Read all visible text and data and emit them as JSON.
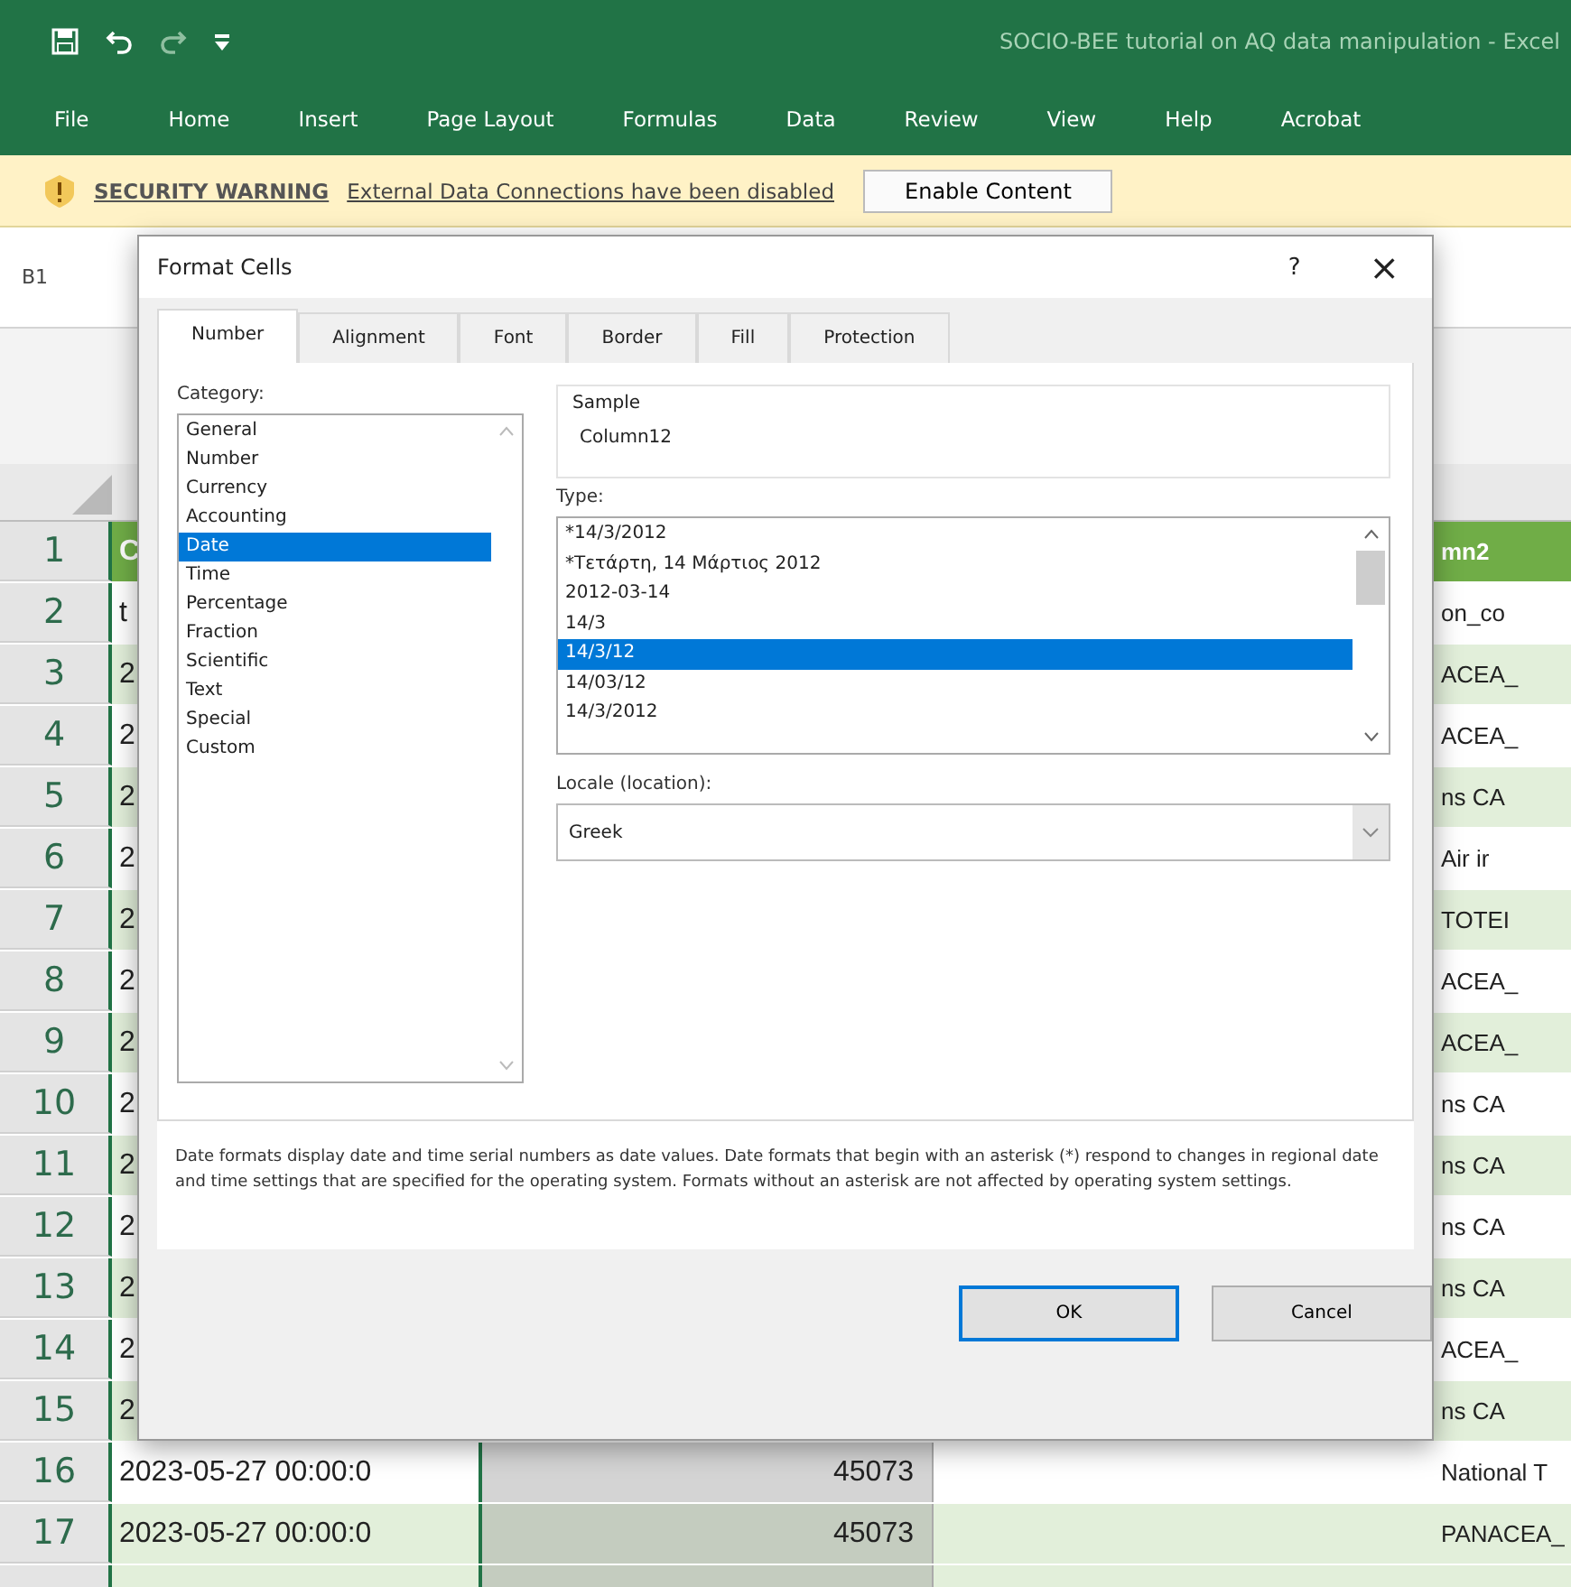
{
  "window": {
    "title": "SOCIO-BEE tutorial on AQ data manipulation  -  Excel"
  },
  "ribbon_tabs": [
    "File",
    "Home",
    "Insert",
    "Page Layout",
    "Formulas",
    "Data",
    "Review",
    "View",
    "Help",
    "Acrobat"
  ],
  "security_bar": {
    "label": "SECURITY WARNING",
    "message": "External Data Connections have been disabled",
    "button": "Enable Content"
  },
  "name_box": "B1",
  "sheet": {
    "rows": [
      {
        "number": "1",
        "col_a": "C",
        "col_d": "mn2"
      },
      {
        "number": "2",
        "col_a": "t",
        "col_d": "on_co"
      },
      {
        "number": "3",
        "col_a": "2",
        "col_d": "ACEA_"
      },
      {
        "number": "4",
        "col_a": "2",
        "col_d": "ACEA_"
      },
      {
        "number": "5",
        "col_a": "2",
        "col_d": "ns CA"
      },
      {
        "number": "6",
        "col_a": "2",
        "col_d": "Air ir"
      },
      {
        "number": "7",
        "col_a": "2",
        "col_d": "TOTEI"
      },
      {
        "number": "8",
        "col_a": "2",
        "col_d": "ACEA_"
      },
      {
        "number": "9",
        "col_a": "2",
        "col_d": "ACEA_"
      },
      {
        "number": "10",
        "col_a": "2",
        "col_d": "ns CA"
      },
      {
        "number": "11",
        "col_a": "2",
        "col_d": "ns CA"
      },
      {
        "number": "12",
        "col_a": "2",
        "col_d": "ns CA"
      },
      {
        "number": "13",
        "col_a": "2",
        "col_d": "ns CA"
      },
      {
        "number": "14",
        "col_a": "2",
        "col_d": "ACEA_"
      },
      {
        "number": "15",
        "col_a": "2",
        "col_d": "ns CA"
      },
      {
        "number": "16",
        "col_a": "2023-05-27 00:00:0",
        "col_b": "45073",
        "col_d": "National T"
      },
      {
        "number": "17",
        "col_a": "2023-05-27 00:00:0",
        "col_b": "45073",
        "col_d": "PANACEA_"
      }
    ]
  },
  "dialog": {
    "title": "Format Cells",
    "help": "?",
    "close": "×",
    "tabs": [
      {
        "label": "Number",
        "selected": true
      },
      {
        "label": "Alignment",
        "selected": false
      },
      {
        "label": "Font",
        "selected": false
      },
      {
        "label": "Border",
        "selected": false
      },
      {
        "label": "Fill",
        "selected": false
      },
      {
        "label": "Protection",
        "selected": false
      }
    ],
    "category_label": "Category:",
    "categories": [
      {
        "label": "General",
        "selected": false
      },
      {
        "label": "Number",
        "selected": false
      },
      {
        "label": "Currency",
        "selected": false
      },
      {
        "label": "Accounting",
        "selected": false
      },
      {
        "label": "Date",
        "selected": true
      },
      {
        "label": "Time",
        "selected": false
      },
      {
        "label": "Percentage",
        "selected": false
      },
      {
        "label": "Fraction",
        "selected": false
      },
      {
        "label": "Scientific",
        "selected": false
      },
      {
        "label": "Text",
        "selected": false
      },
      {
        "label": "Special",
        "selected": false
      },
      {
        "label": "Custom",
        "selected": false
      }
    ],
    "sample_label": "Sample",
    "sample_value": "Column12",
    "type_label": "Type:",
    "types": [
      {
        "label": "*14/3/2012",
        "selected": false
      },
      {
        "label": "*Τετάρτη, 14 Μάρτιος 2012",
        "selected": false
      },
      {
        "label": "2012-03-14",
        "selected": false
      },
      {
        "label": "14/3",
        "selected": false
      },
      {
        "label": "14/3/12",
        "selected": true
      },
      {
        "label": "14/03/12",
        "selected": false
      },
      {
        "label": "14/3/2012",
        "selected": false
      }
    ],
    "locale_label": "Locale (location):",
    "locale_value": "Greek",
    "description": "Date formats display date and time serial numbers as date values.  Date formats that begin with an asterisk (*) respond to changes in regional date and time settings that are specified for the operating system. Formats without an asterisk are not affected by operating system settings.",
    "ok": "OK",
    "cancel": "Cancel"
  }
}
